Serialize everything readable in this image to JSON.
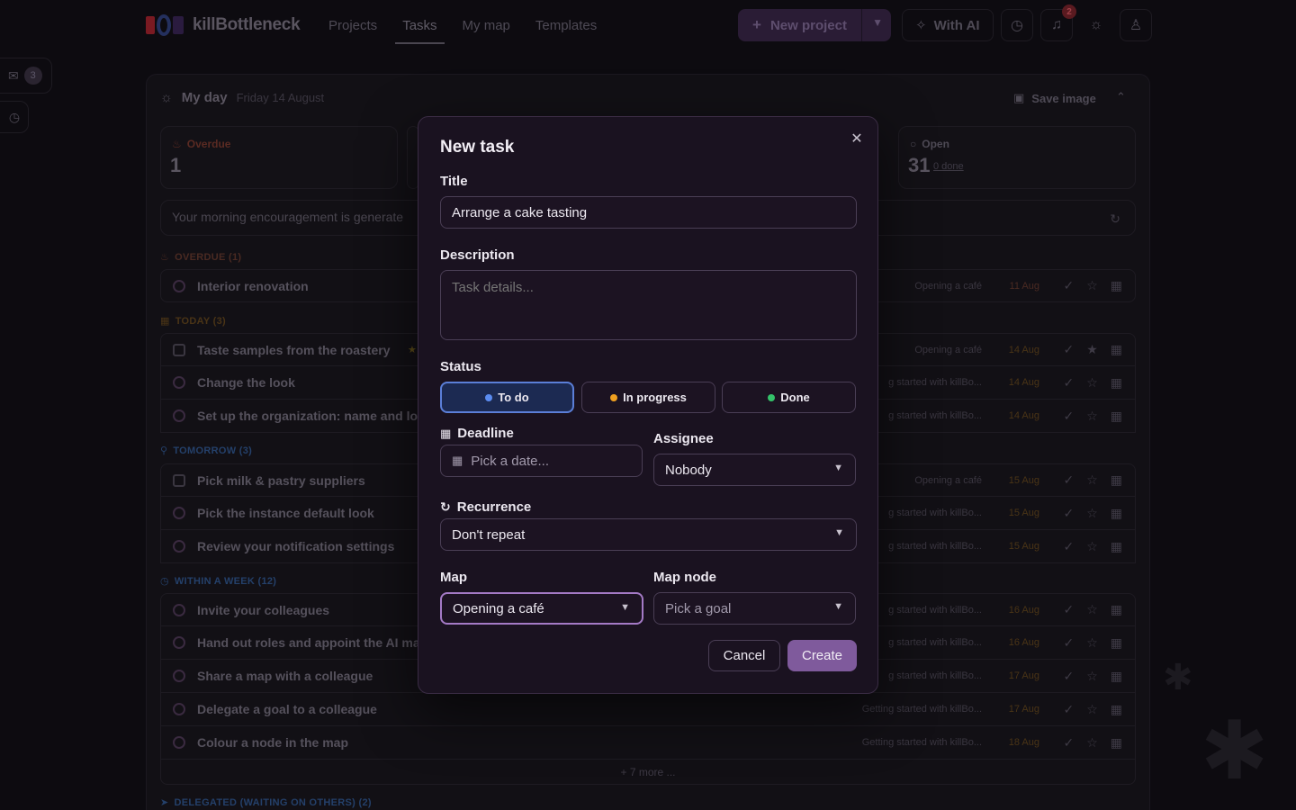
{
  "app": {
    "name": "killBottleneck",
    "nav": [
      "Projects",
      "Tasks",
      "My map",
      "Templates"
    ],
    "new_project": "New project",
    "with_ai": "With AI",
    "notification_count": "2",
    "inbox_count": "3"
  },
  "myday": {
    "title": "My day",
    "date": "Friday 14 August",
    "save_image": "Save image",
    "cards": {
      "overdue_label": "Overdue",
      "overdue_count": "1",
      "open_label": "Open",
      "open_count": "31",
      "open_done": "0 done"
    },
    "encouragement": "Your morning encouragement is generate",
    "more": "+ 7 more ...",
    "sections": {
      "overdue": "OVERDUE (1)",
      "today": "TODAY (3)",
      "tomorrow": "TOMORROW (3)",
      "week": "WITHIN A WEEK (12)",
      "delegated": "DELEGATED (WAITING ON OTHERS) (2)"
    },
    "tasks": [
      {
        "name": "Interior renovation",
        "map": "Opening a café",
        "due": "11 Aug"
      },
      {
        "name": "Taste samples from the roastery",
        "map": "Opening a café",
        "due": "14 Aug"
      },
      {
        "name": "Change the look",
        "map": "g started with killBo...",
        "due": "14 Aug"
      },
      {
        "name": "Set up the organization: name and lo",
        "map": "g started with killBo...",
        "due": "14 Aug"
      },
      {
        "name": "Pick milk & pastry suppliers",
        "map": "Opening a café",
        "due": "15 Aug"
      },
      {
        "name": "Pick the instance default look",
        "map": "g started with killBo...",
        "due": "15 Aug"
      },
      {
        "name": "Review your notification settings",
        "map": "g started with killBo...",
        "due": "15 Aug"
      },
      {
        "name": "Invite your colleagues",
        "map": "g started with killBo...",
        "due": "16 Aug"
      },
      {
        "name": "Hand out roles and appoint the AI ma",
        "map": "g started with killBo...",
        "due": "16 Aug"
      },
      {
        "name": "Share a map with a colleague",
        "map": "g started with killBo...",
        "due": "17 Aug"
      },
      {
        "name": "Delegate a goal to a colleague",
        "map": "Getting started with killBo...",
        "due": "17 Aug"
      },
      {
        "name": "Colour a node in the map",
        "map": "Getting started with killBo...",
        "due": "18 Aug"
      }
    ]
  },
  "modal": {
    "title": "New task",
    "title_label": "Title",
    "title_value": "Arrange a cake tasting",
    "description_label": "Description",
    "description_placeholder": "Task details...",
    "status_label": "Status",
    "status_options": [
      "To do",
      "In progress",
      "Done"
    ],
    "status_colors": [
      "#5b8cf0",
      "#f0a020",
      "#34c26a"
    ],
    "deadline_label": "Deadline",
    "deadline_placeholder": "Pick a date...",
    "assignee_label": "Assignee",
    "assignee_value": "Nobody",
    "recurrence_label": "Recurrence",
    "recurrence_value": "Don't repeat",
    "map_label": "Map",
    "map_value": "Opening a café",
    "map_node_label": "Map node",
    "map_node_placeholder": "Pick a goal",
    "cancel": "Cancel",
    "create": "Create"
  }
}
